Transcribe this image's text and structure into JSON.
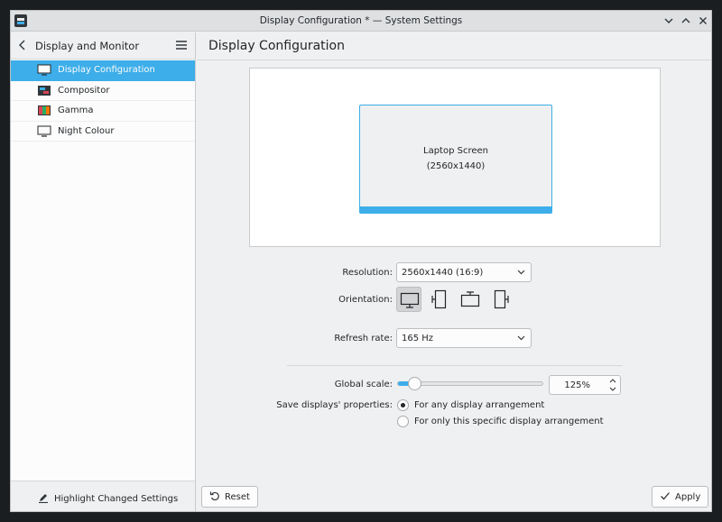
{
  "window": {
    "title": "Display Configuration * — System Settings"
  },
  "sidebar": {
    "title": "Display and Monitor",
    "items": [
      {
        "label": "Display Configuration",
        "icon": "monitor-icon",
        "active": true
      },
      {
        "label": "Compositor",
        "icon": "compositor-icon",
        "active": false
      },
      {
        "label": "Gamma",
        "icon": "gamma-icon",
        "active": false
      },
      {
        "label": "Night Colour",
        "icon": "night-colour-icon",
        "active": false
      }
    ],
    "footer_label": "Highlight Changed Settings"
  },
  "main": {
    "title": "Display Configuration",
    "screen": {
      "name": "Laptop Screen",
      "resolution": "(2560x1440)"
    },
    "resolution_label": "Resolution:",
    "resolution_value": "2560x1440 (16:9)",
    "orientation_label": "Orientation:",
    "refresh_label": "Refresh rate:",
    "refresh_value": "165 Hz",
    "scale_label": "Global scale:",
    "scale_value": "125%",
    "scale_fraction": 0.125,
    "save_label": "Save displays' properties:",
    "save_options": [
      {
        "label": "For any display arrangement",
        "selected": true
      },
      {
        "label": "For only this specific display arrangement",
        "selected": false
      }
    ],
    "reset_label": "Reset",
    "apply_label": "Apply"
  },
  "colors": {
    "accent": "#3daee9",
    "background": "#eff0f1",
    "text": "#232629"
  }
}
